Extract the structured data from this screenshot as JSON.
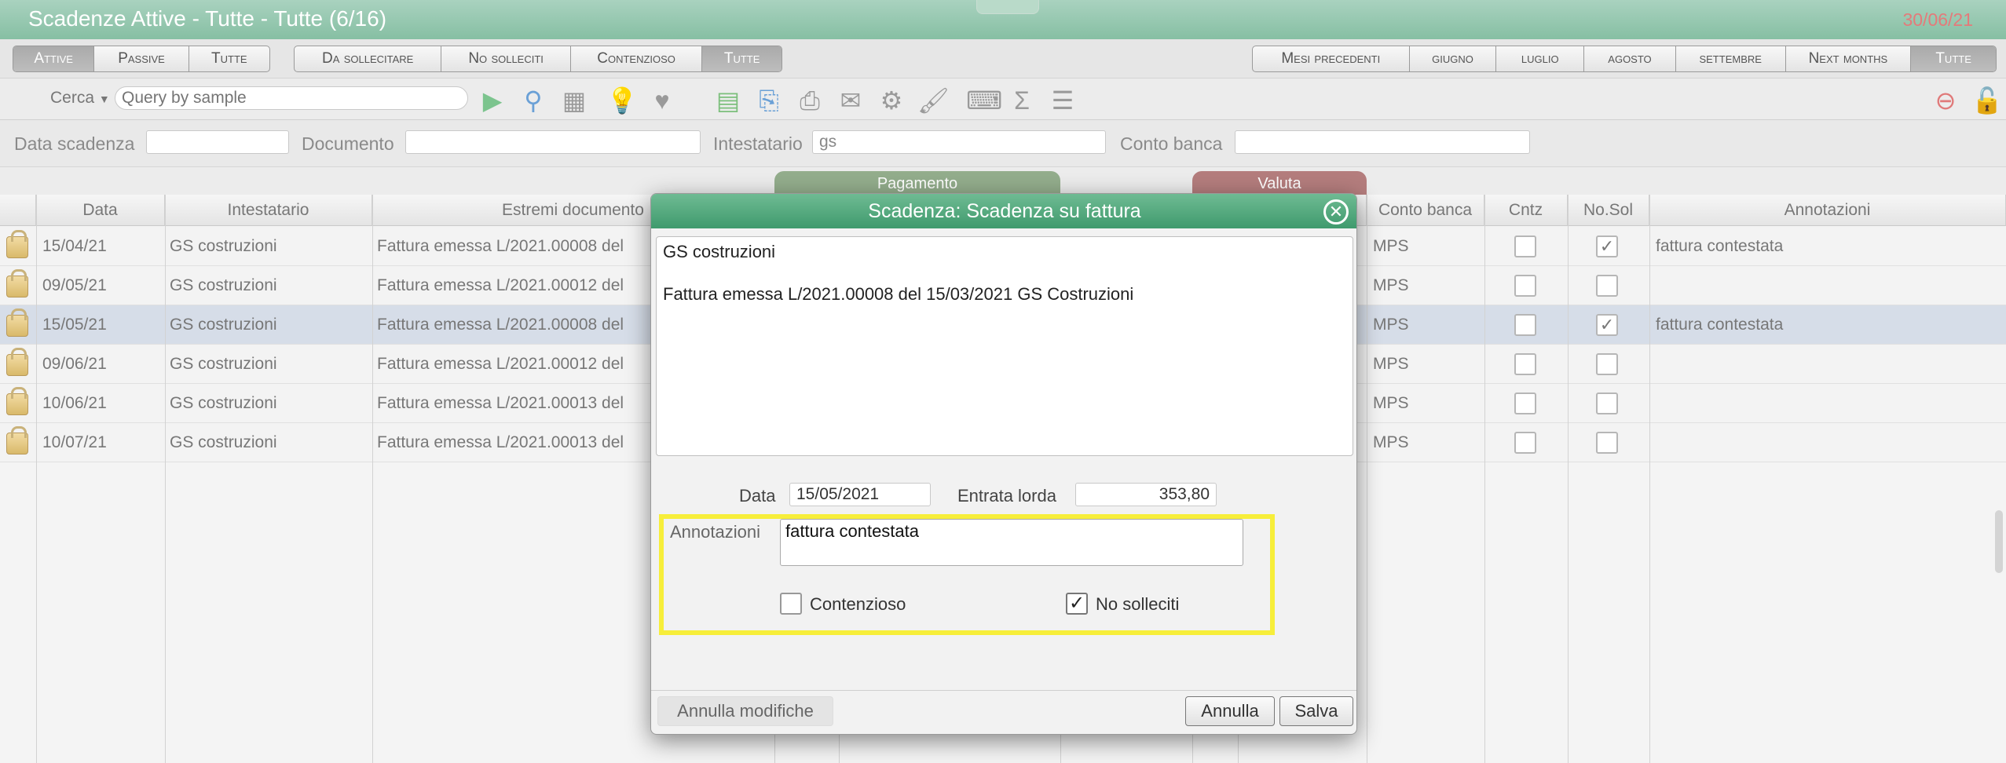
{
  "window": {
    "title": "Scadenze Attive - Tutte - Tutte (6/16)",
    "date": "30/06/21"
  },
  "filters": {
    "tipo": [
      "Attive",
      "Passive",
      "Tutte"
    ],
    "stato": [
      "Da sollecitare",
      "No solleciti",
      "Contenzioso",
      "Tutte"
    ],
    "mesi": [
      "Mesi precedenti",
      "giugno",
      "luglio",
      "agosto",
      "settembre",
      "Next months",
      "Tutte"
    ]
  },
  "toolbar": {
    "cerca_label": "Cerca",
    "search_placeholder": "Query by sample"
  },
  "search_fields": {
    "data_label": "Data scadenza",
    "documento_label": "Documento",
    "intestatario_label": "Intestatario",
    "intestatario_value": "gs",
    "conto_label": "Conto banca"
  },
  "groups": {
    "pagamento": "Pagamento",
    "valuta": "Valuta"
  },
  "columns": {
    "data": "Data",
    "intestatario": "Intestatario",
    "estremi": "Estremi documento",
    "conto": "Conto banca",
    "cntz": "Cntz",
    "nosol": "No.Sol",
    "annotazioni": "Annotazioni"
  },
  "rows": [
    {
      "data": "15/04/21",
      "intestatario": "GS costruzioni",
      "estremi": "Fattura emessa L/2021.00008 del",
      "conto": "MPS",
      "cntz": false,
      "nosol": true,
      "annotazioni": "fattura contestata"
    },
    {
      "data": "09/05/21",
      "intestatario": "GS costruzioni",
      "estremi": "Fattura emessa L/2021.00012 del",
      "conto": "MPS",
      "cntz": false,
      "nosol": false,
      "annotazioni": ""
    },
    {
      "data": "15/05/21",
      "intestatario": "GS costruzioni",
      "estremi": "Fattura emessa L/2021.00008 del",
      "conto": "MPS",
      "cntz": false,
      "nosol": true,
      "annotazioni": "fattura contestata"
    },
    {
      "data": "09/06/21",
      "intestatario": "GS costruzioni",
      "estremi": "Fattura emessa L/2021.00012 del",
      "conto": "MPS",
      "cntz": false,
      "nosol": false,
      "annotazioni": ""
    },
    {
      "data": "10/06/21",
      "intestatario": "GS costruzioni",
      "estremi": "Fattura emessa L/2021.00013 del",
      "conto": "MPS",
      "cntz": false,
      "nosol": false,
      "annotazioni": ""
    },
    {
      "data": "10/07/21",
      "intestatario": "GS costruzioni",
      "estremi": "Fattura emessa L/2021.00013 del",
      "conto": "MPS",
      "cntz": false,
      "nosol": false,
      "annotazioni": ""
    }
  ],
  "dialog": {
    "title": "Scadenza: Scadenza su fattura",
    "line1": "GS costruzioni",
    "line2": "Fattura emessa L/2021.00008 del 15/03/2021 GS Costruzioni",
    "data_label": "Data",
    "data_value": "15/05/2021",
    "entrata_label": "Entrata lorda",
    "entrata_value": "353,80",
    "annotazioni_label": "Annotazioni",
    "annotazioni_value": "fattura contestata",
    "contenzioso_label": "Contenzioso",
    "contenzioso_checked": false,
    "nosolleciti_label": "No solleciti",
    "nosolleciti_checked": true,
    "annulla_modifiche": "Annulla modifiche",
    "annulla": "Annulla",
    "salva": "Salva"
  },
  "colors": {
    "title_green": "#86bfa3",
    "pagamento": "#93ad8c",
    "valuta": "#b47d7d",
    "highlight": "#f7ee3a"
  }
}
